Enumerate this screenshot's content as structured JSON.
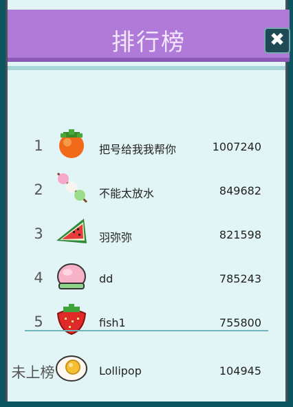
{
  "header": {
    "title": "排行榜",
    "close_label": "✖"
  },
  "leaderboard": [
    {
      "rank": "1",
      "icon": "persimmon-icon",
      "name": "把号给我我帮你",
      "score": "1007240"
    },
    {
      "rank": "2",
      "icon": "dango-skewer-icon",
      "name": "不能太放水",
      "score": "849682"
    },
    {
      "rank": "3",
      "icon": "watermelon-slice-icon",
      "name": "羽弥弥",
      "score": "821598"
    },
    {
      "rank": "4",
      "icon": "peach-icon",
      "name": "dd",
      "score": "785243"
    },
    {
      "rank": "5",
      "icon": "strawberry-icon",
      "name": "fish1",
      "score": "755800"
    }
  ],
  "self_entry": {
    "rank": "未上榜",
    "icon": "fried-egg-icon",
    "name": "Lollipop",
    "score": "104945"
  },
  "colors": {
    "header_bg": "#b07ad8",
    "panel_bg": "#e2f5f6",
    "frame": "#0d5560"
  }
}
